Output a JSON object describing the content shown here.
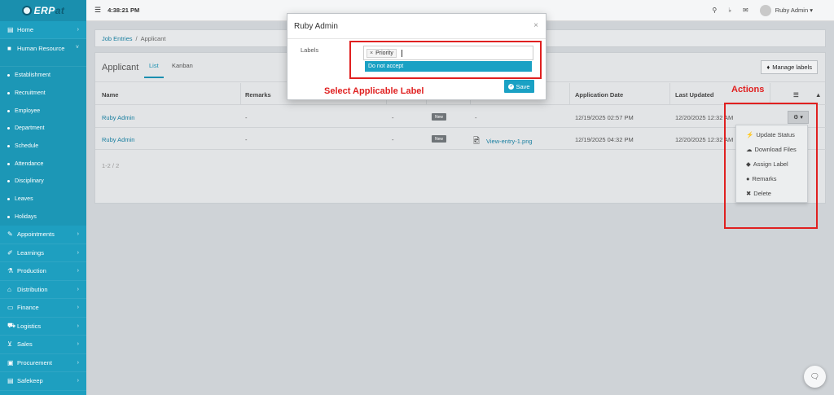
{
  "brand": {
    "logo_text_1": "ERP",
    "logo_text_2": "at"
  },
  "topbar": {
    "menu_icon": "hamburger-icon",
    "time": "4:38:21 PM",
    "user_name": "Ruby Admin ▾"
  },
  "sidebar": {
    "home": "Home",
    "human_resource": "Human Resource",
    "sub_items": [
      "Establishment",
      "Recruitment",
      "Employee",
      "Department",
      "Schedule",
      "Attendance",
      "Disciplinary",
      "Leaves",
      "Holidays"
    ],
    "main_items": [
      "Appointments",
      "Learnings",
      "Production",
      "Distribution",
      "Finance",
      "Logistics",
      "Sales",
      "Procurement",
      "Safekeep"
    ]
  },
  "breadcrumb": {
    "parent": "Job Entries",
    "separator": "/",
    "current": "Applicant"
  },
  "panel": {
    "title": "Applicant",
    "tabs": [
      "List",
      "Kanban"
    ],
    "manage_labels": "Manage labels",
    "columns": {
      "name": "Name",
      "remarks": "Remarks",
      "application_date": "Application Date",
      "last_updated": "Last Updated"
    },
    "rows": [
      {
        "name": "Ruby Admin",
        "remarks": "-",
        "dash": "-",
        "badge": "New",
        "file": "-",
        "app_date": "12/19/2025 02:57 PM",
        "updated": "12/20/2025 12:32 AM"
      },
      {
        "name": "Ruby Admin",
        "remarks": "-",
        "dash": "-",
        "badge": "New",
        "file": "View-entry-1.png",
        "app_date": "12/19/2025 04:32 PM",
        "updated": "12/20/2025 12:32 AM"
      }
    ],
    "pager": "1-2 / 2"
  },
  "actions_menu": [
    "Update Status",
    "Download Files",
    "Assign Label",
    "Remarks",
    "Delete"
  ],
  "modal": {
    "title": "Ruby Admin",
    "close": "×",
    "labels_label": "Labels",
    "tag": "Priority",
    "tag_remove": "×",
    "option": "Do not accept",
    "save": "Save"
  },
  "annotations": {
    "select_label": "Select Applicable Label",
    "actions": "Actions"
  },
  "colors": {
    "sidebar": "#1e9fc0",
    "accent": "#1aa1c4",
    "annotation": "#e02020"
  }
}
